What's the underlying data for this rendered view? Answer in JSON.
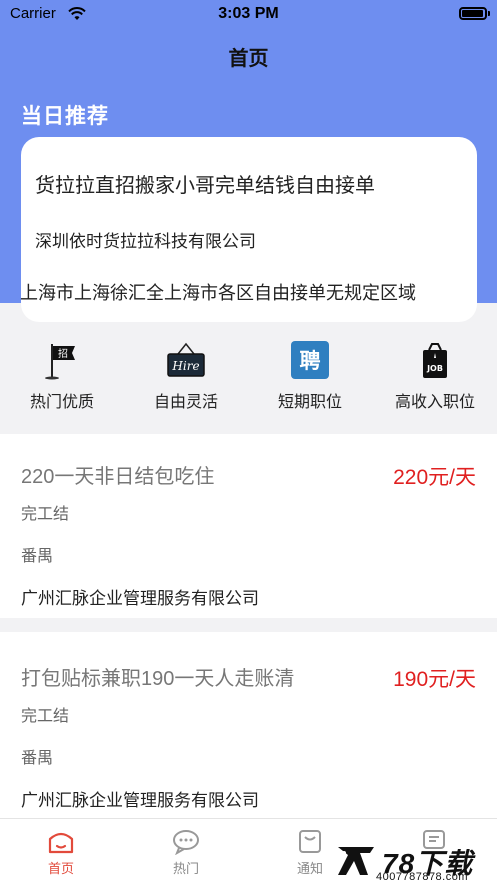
{
  "status_bar": {
    "carrier": "Carrier",
    "time": "3:03 PM"
  },
  "nav": {
    "title": "首页"
  },
  "recommend": {
    "section_title": "当日推荐",
    "title": "货拉拉直招搬家小哥完单结钱自由接单",
    "company": "深圳依时货拉拉科技有限公司",
    "area": "上海市上海徐汇全上海市各区自由接单无规定区域"
  },
  "categories": [
    {
      "label": "热门优质",
      "icon": "flag-icon"
    },
    {
      "label": "自由灵活",
      "icon": "hire-sign-icon"
    },
    {
      "label": "短期职位",
      "icon": "pin-badge-icon"
    },
    {
      "label": "高收入职位",
      "icon": "job-bag-icon"
    }
  ],
  "jobs": [
    {
      "title": "220一天非日结包吃住",
      "salary": "220元/天",
      "settle": "完工结",
      "area": "番禺",
      "company": "广州汇脉企业管理服务有限公司"
    },
    {
      "title": "打包贴标兼职190一天人走账清",
      "salary": "190元/天",
      "settle": "完工结",
      "area": "番禺",
      "company": "广州汇脉企业管理服务有限公司"
    }
  ],
  "tabs": [
    {
      "label": "首页",
      "icon": "home-icon",
      "active": true
    },
    {
      "label": "热门",
      "icon": "chat-bubble-icon",
      "active": false
    },
    {
      "label": "通知",
      "icon": "bag-icon",
      "active": false
    },
    {
      "label": "",
      "icon": "message-icon",
      "active": false
    }
  ],
  "watermark": {
    "brand": "78下载",
    "sub": "4007787878.com"
  },
  "colors": {
    "header": "#6e8ef0",
    "salary": "#e02020",
    "active_tab": "#e24a3b"
  },
  "category_icon_glyphs": {
    "flag": "招",
    "hire": "Hire",
    "pin": "聘",
    "job": "JOB"
  }
}
